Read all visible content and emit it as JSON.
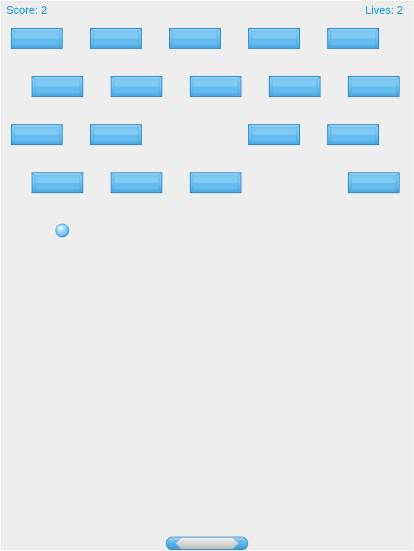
{
  "hud": {
    "score_label": "Score: 2",
    "lives_label": "Lives: 2"
  },
  "game_state": {
    "score": 2,
    "lives": 2
  },
  "bricks": {
    "rows": 4,
    "columns": 5,
    "present": [
      [
        true,
        true,
        true,
        true,
        true
      ],
      [
        true,
        true,
        true,
        true,
        true
      ],
      [
        true,
        true,
        false,
        true,
        true
      ],
      [
        true,
        true,
        true,
        false,
        true
      ]
    ]
  },
  "colors": {
    "background": "#eeeeee",
    "text": "#0095dd",
    "brick_fill": "#63bdf0",
    "brick_edge": "#3a8fc6",
    "ball_fill": "#8ed2fa",
    "paddle_body": "#5ab4ea",
    "paddle_center": "#d6d6d6"
  }
}
